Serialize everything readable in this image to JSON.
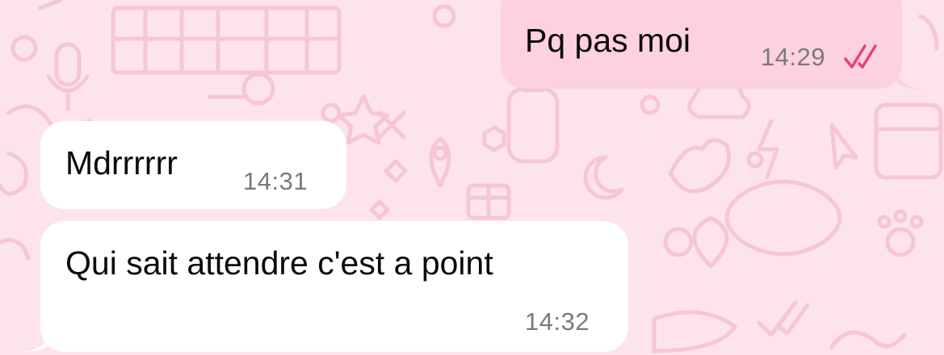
{
  "theme": {
    "wallpaper_color": "#fde3ec",
    "doodle_color": "#f6c6d6",
    "outgoing_bubble_color": "#fdd1e1",
    "incoming_bubble_color": "#ffffff",
    "read_receipt_color": "#e8407a"
  },
  "messages": [
    {
      "direction": "outgoing",
      "text": "Pq pas moi",
      "time": "14:29",
      "status_icon": "double-check-read-icon"
    },
    {
      "direction": "incoming",
      "text": "Mdrrrrrr",
      "time": "14:31"
    },
    {
      "direction": "incoming",
      "text": "Qui sait attendre c'est a point",
      "time": "14:32"
    }
  ]
}
